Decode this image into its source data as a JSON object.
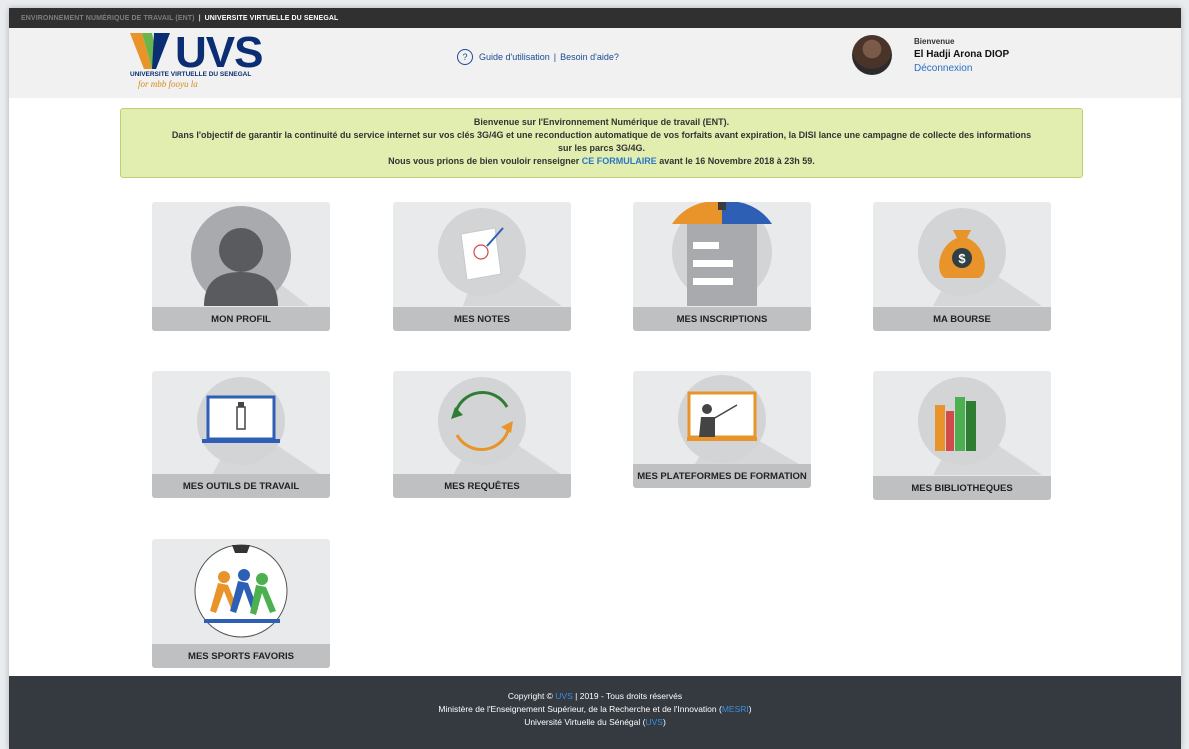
{
  "topbar": {
    "ent_label": "ENVIRONNEMENT NUMÉRIQUE DE TRAVAIL (ENT)",
    "separator": "|",
    "university": "UNIVERSITE VIRTUELLE DU SENEGAL"
  },
  "logo": {
    "brand": "UVS",
    "subtitle": "UNIVERSITE VIRTUELLE DU SENEGAL",
    "tagline": "for mbb fooyu la"
  },
  "help": {
    "icon": "question-icon",
    "guide": "Guide d'utilisation",
    "separator": "|",
    "support": "Besoin d'aide?"
  },
  "user": {
    "welcome": "Bienvenue",
    "name": "El Hadji Arona DIOP",
    "logout": "Déconnexion"
  },
  "notice": {
    "line1": "Bienvenue sur l'Environnement Numérique de travail (ENT).",
    "line2": "Dans l'objectif de garantir la continuité du service internet sur vos clés 3G/4G et une reconduction automatique de vos forfaits avant expiration, la DISI lance une campagne de collecte des informations",
    "line3": "sur les parcs 3G/4G.",
    "line4_before": "Nous vous prions de bien vouloir renseigner ",
    "line4_link": "CE FORMULAIRE",
    "line4_after": " avant le 16 Novembre 2018 à 23h 59."
  },
  "tiles": [
    {
      "label": "MON PROFIL",
      "icon": "user-icon"
    },
    {
      "label": "MES NOTES",
      "icon": "grade-sheet-icon"
    },
    {
      "label": "MES INSCRIPTIONS",
      "icon": "clipboard-icon"
    },
    {
      "label": "MA BOURSE",
      "icon": "money-bag-icon"
    },
    {
      "label": "MES OUTILS DE TRAVAIL",
      "icon": "laptop-usb-icon"
    },
    {
      "label": "MES REQUÊTES",
      "icon": "refresh-arrows-icon"
    },
    {
      "label": "MES PLATEFORMES DE FORMATION",
      "icon": "presentation-board-icon"
    },
    {
      "label": "MES BIBLIOTHEQUES",
      "icon": "books-icon"
    },
    {
      "label": "MES SPORTS FAVORIS",
      "icon": "runners-icon"
    }
  ],
  "footer": {
    "copy_before": "Copyright © ",
    "copy_link": "UVS",
    "copy_after": " | 2019 - Tous droits réservés",
    "ministry_before": "Ministère de l'Enseignement Supérieur, de la Recherche et de l'Innovation (",
    "ministry_link": "MESRI",
    "ministry_after": ")",
    "univ_before": "Université Virtuelle du Sénégal (",
    "univ_link": "UVS",
    "univ_after": ")"
  },
  "colors": {
    "navy": "#0b2e73",
    "orange": "#e8942a",
    "notice_bg": "#e2eeb0",
    "link": "#2a75c9",
    "footer_bg": "#343a40"
  }
}
